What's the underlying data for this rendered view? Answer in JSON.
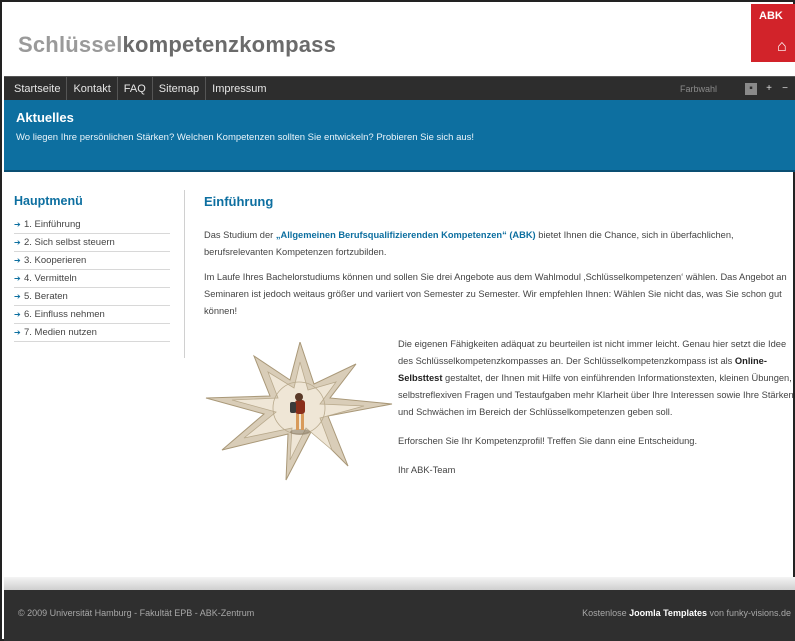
{
  "header": {
    "title_light": "Schlüssel",
    "title_bold": "kompetenzkompass",
    "logo_text": "ABK"
  },
  "nav": {
    "items": [
      "Startseite",
      "Kontakt",
      "FAQ",
      "Sitemap",
      "Impressum"
    ],
    "color_choice_label": "Farbwahl",
    "font_controls": [
      "▪",
      "+",
      "−"
    ]
  },
  "banner": {
    "title": "Aktuelles",
    "text": "Wo liegen Ihre persönlichen Stärken? Welchen Kompetenzen sollten Sie entwickeln? Probieren Sie sich aus!"
  },
  "sidebar": {
    "title": "Hauptmenü",
    "items": [
      "1. Einführung",
      "2. Sich selbst steuern",
      "3. Kooperieren",
      "4. Vermitteln",
      "5. Beraten",
      "6. Einfluss nehmen",
      "7. Medien nutzen"
    ]
  },
  "main": {
    "title": "Einführung",
    "p1_before": "Das Studium der ",
    "p1_highlight": "„Allgemeinen Berufsqualifizierenden Kompetenzen“ (ABK)",
    "p1_after": " bietet Ihnen die Chance, sich in überfachlichen, berufsrelevanten Kompetenzen fortzubilden.",
    "p2": "Im Laufe Ihres Bachelorstudiums können und sollen Sie drei Angebote aus dem Wahlmodul ‚Schlüsselkompetenzen‘ wählen. Das Angebot an Seminaren ist jedoch weitaus größer und variiert von Semester zu Semester. Wir empfehlen Ihnen: Wählen Sie nicht das, was Sie schon gut können!",
    "p3_before": "Die eigenen Fähigkeiten adäquat zu beurteilen ist nicht immer leicht. Genau hier setzt die Idee des Schlüsselkompetenzkompasses an. Der Schlüsselkompetenzkompass ist als ",
    "p3_strong": "Online-Selbsttest",
    "p3_after": " gestaltet, der Ihnen mit Hilfe von einführenden Informationstexten, kleinen Übungen, selbstreflexiven Fragen und Testaufgaben mehr Klarheit über Ihre Interessen sowie Ihre Stärken und Schwächen im Bereich der Schlüsselkompetenzen geben soll.",
    "p4": "Erforschen Sie Ihr Kompetenzprofil! Treffen Sie dann eine Entscheidung.",
    "p5": "Ihr ABK-Team"
  },
  "footer": {
    "left": "© 2009 Universität Hamburg - Fakultät EPB - ABK-Zentrum",
    "right_before": "Kostenlose ",
    "right_link": "Joomla Templates",
    "right_after": " von funky-visions.de"
  },
  "colors": {
    "accent": "#0d6fa0",
    "nav_bg": "#2d2d2d",
    "footer_bg": "#2f2f2f",
    "logo_red": "#d2232a"
  }
}
